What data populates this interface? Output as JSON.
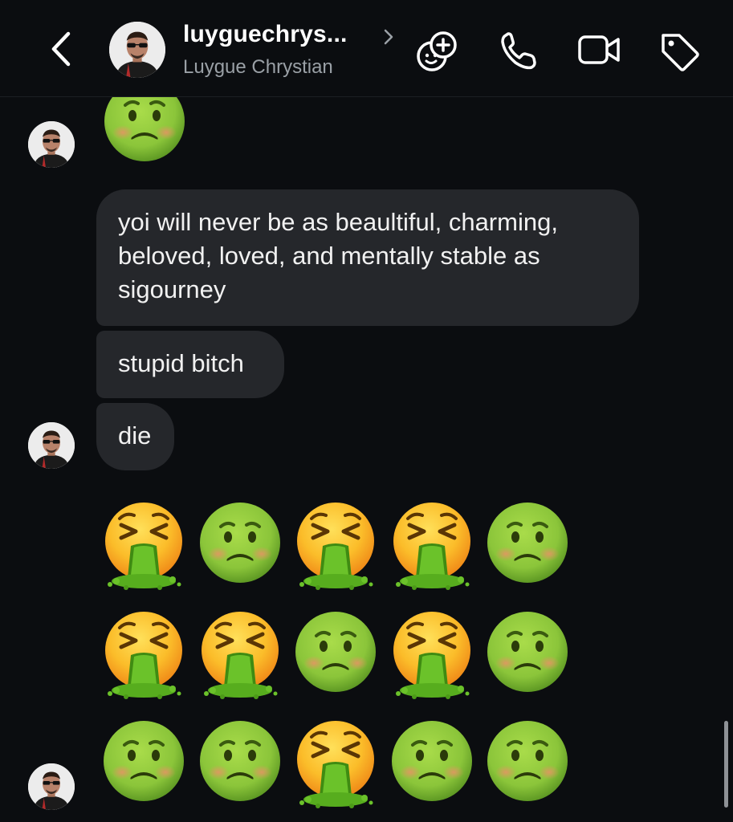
{
  "header": {
    "username": "luyguechrys...",
    "display_name": "Luygue Chrystian"
  },
  "messages": [
    {
      "type": "emoji",
      "emoji": [
        "woozy-sick-face"
      ]
    },
    {
      "type": "text",
      "text": "yoi will never be as beaultiful, charming, beloved, loved, and mentally stable as sigourney"
    },
    {
      "type": "text",
      "text": "stupid bitch"
    },
    {
      "type": "text",
      "text": "die"
    },
    {
      "type": "emoji",
      "emoji": [
        "vomiting-face",
        "nauseated-face",
        "vomiting-face",
        "vomiting-face",
        "nauseated-face",
        "vomiting-face",
        "vomiting-face",
        "nauseated-face",
        "vomiting-face",
        "nauseated-face",
        "nauseated-face",
        "nauseated-face",
        "vomiting-face",
        "nauseated-face",
        "nauseated-face"
      ]
    }
  ],
  "colors": {
    "background": "#0b0d10",
    "bubble": "#25272b",
    "subtitle": "#9aa0a6"
  }
}
